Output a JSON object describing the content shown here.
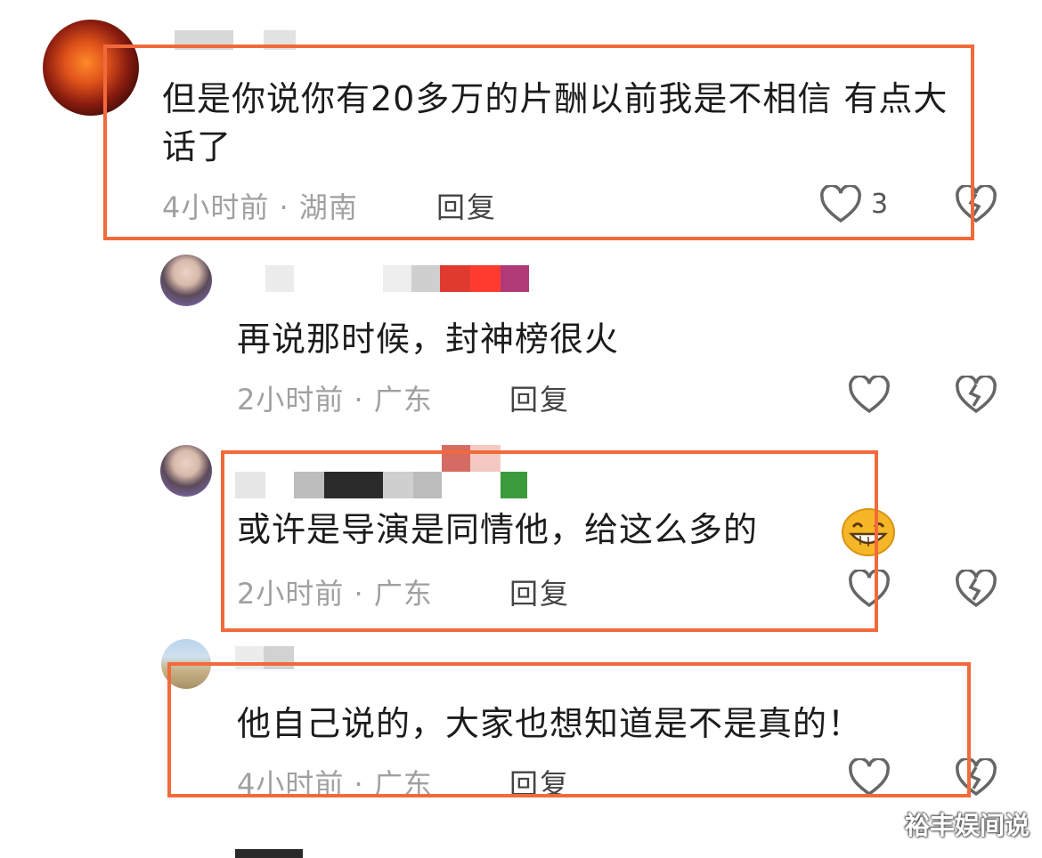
{
  "comments": [
    {
      "text": "但是你说你有20多万的片酬以前我是不相信 有点大话了",
      "time_location": "4小时前 · 湖南",
      "reply_label": "回复",
      "like_count": "3"
    },
    {
      "text": "再说那时候，封神榜很火",
      "time_location": "2小时前 · 广东",
      "reply_label": "回复"
    },
    {
      "text": "或许是导演是同情他，给这么多的",
      "time_location": "2小时前 · 广东",
      "reply_label": "回复"
    },
    {
      "text": "他自己说的，大家也想知道是不是真的！",
      "time_location": "4小时前 · 广东",
      "reply_label": "回复"
    }
  ],
  "watermark": "裕丰娱间说",
  "colors": {
    "highlight_frame": "#f26a3c",
    "meta_text": "#a0a0a0"
  },
  "icons": [
    "heart-icon",
    "broken-heart-icon",
    "grinning-emoji-icon"
  ]
}
